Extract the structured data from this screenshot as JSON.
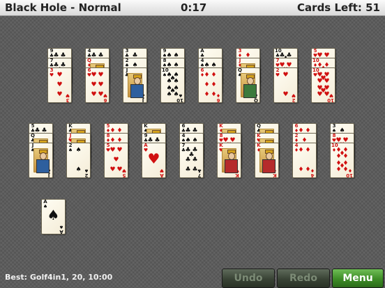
{
  "topbar": {
    "title": "Black Hole - Normal",
    "timer": "0:17",
    "cards_left": "Cards Left: 51"
  },
  "colors": {
    "felt": "#5a5a5a",
    "card_red": "#d01010",
    "card_black": "#111111",
    "menu_button": "#3d8c26"
  },
  "tableau": [
    {
      "cards": [
        {
          "rank": "9",
          "suit": "♣"
        },
        {
          "rank": "7",
          "suit": "♣"
        },
        {
          "rank": "3",
          "suit": "♥"
        }
      ]
    },
    {
      "cards": [
        {
          "rank": "4",
          "suit": "♣"
        },
        {
          "rank": "Q",
          "suit": "♦"
        },
        {
          "rank": "6",
          "suit": "♥"
        }
      ]
    },
    {
      "cards": [
        {
          "rank": "3",
          "suit": "♣"
        },
        {
          "rank": "2",
          "suit": "♠"
        },
        {
          "rank": "J",
          "suit": "♣"
        }
      ]
    },
    {
      "cards": [
        {
          "rank": "9",
          "suit": "♠"
        },
        {
          "rank": "8",
          "suit": "♠"
        },
        {
          "rank": "10",
          "suit": "♠"
        }
      ]
    },
    {
      "cards": [
        {
          "rank": "A",
          "suit": "♣"
        },
        {
          "rank": "4",
          "suit": "♠"
        },
        {
          "rank": "6",
          "suit": "♦"
        }
      ]
    },
    {
      "cards": [
        {
          "rank": "3",
          "suit": "♦"
        },
        {
          "rank": "J",
          "suit": "♦"
        },
        {
          "rank": "Q",
          "suit": "♠"
        }
      ]
    },
    {
      "cards": [
        {
          "rank": "10",
          "suit": "♣"
        },
        {
          "rank": "7",
          "suit": "♥"
        },
        {
          "rank": "2",
          "suit": "♥"
        }
      ]
    },
    {
      "cards": [
        {
          "rank": "5",
          "suit": "♥"
        },
        {
          "rank": "10",
          "suit": "♦"
        },
        {
          "rank": "10",
          "suit": "♥"
        }
      ]
    },
    {
      "cards": [
        {
          "rank": "5",
          "suit": "♣"
        },
        {
          "rank": "Q",
          "suit": "♣"
        },
        {
          "rank": "J",
          "suit": "♠"
        }
      ]
    },
    {
      "cards": [
        {
          "rank": "K",
          "suit": "♣"
        },
        {
          "rank": "J",
          "suit": "♥"
        },
        {
          "rank": "2",
          "suit": "♠"
        }
      ]
    },
    {
      "cards": [
        {
          "rank": "5",
          "suit": "♦"
        },
        {
          "rank": "8",
          "suit": "♦"
        },
        {
          "rank": "5",
          "suit": "♥"
        }
      ]
    },
    {
      "cards": [
        {
          "rank": "K",
          "suit": "♠"
        },
        {
          "rank": "9",
          "suit": "♣"
        },
        {
          "rank": "A",
          "suit": "♥"
        }
      ]
    },
    {
      "cards": [
        {
          "rank": "6",
          "suit": "♣"
        },
        {
          "rank": "4",
          "suit": "♠"
        },
        {
          "rank": "7",
          "suit": "♣"
        }
      ]
    },
    {
      "cards": [
        {
          "rank": "K",
          "suit": "♦"
        },
        {
          "rank": "8",
          "suit": "♥"
        },
        {
          "rank": "K",
          "suit": "♥"
        }
      ]
    },
    {
      "cards": [
        {
          "rank": "Q",
          "suit": "♣"
        },
        {
          "rank": "K",
          "suit": "♥"
        },
        {
          "rank": "K",
          "suit": "♦"
        }
      ]
    },
    {
      "cards": [
        {
          "rank": "6",
          "suit": "♦"
        },
        {
          "rank": "2",
          "suit": "♦"
        },
        {
          "rank": "4",
          "suit": "♦"
        }
      ]
    },
    {
      "cards": [
        {
          "rank": "3",
          "suit": "♠"
        },
        {
          "rank": "8",
          "suit": "♥"
        },
        {
          "rank": "10",
          "suit": "♦"
        }
      ]
    }
  ],
  "foundation": {
    "rank": "A",
    "suit": "♠"
  },
  "footer": {
    "best": "Best: Golf4in1, 20, 10:00",
    "undo": "Undo",
    "redo": "Redo",
    "menu": "Menu"
  }
}
